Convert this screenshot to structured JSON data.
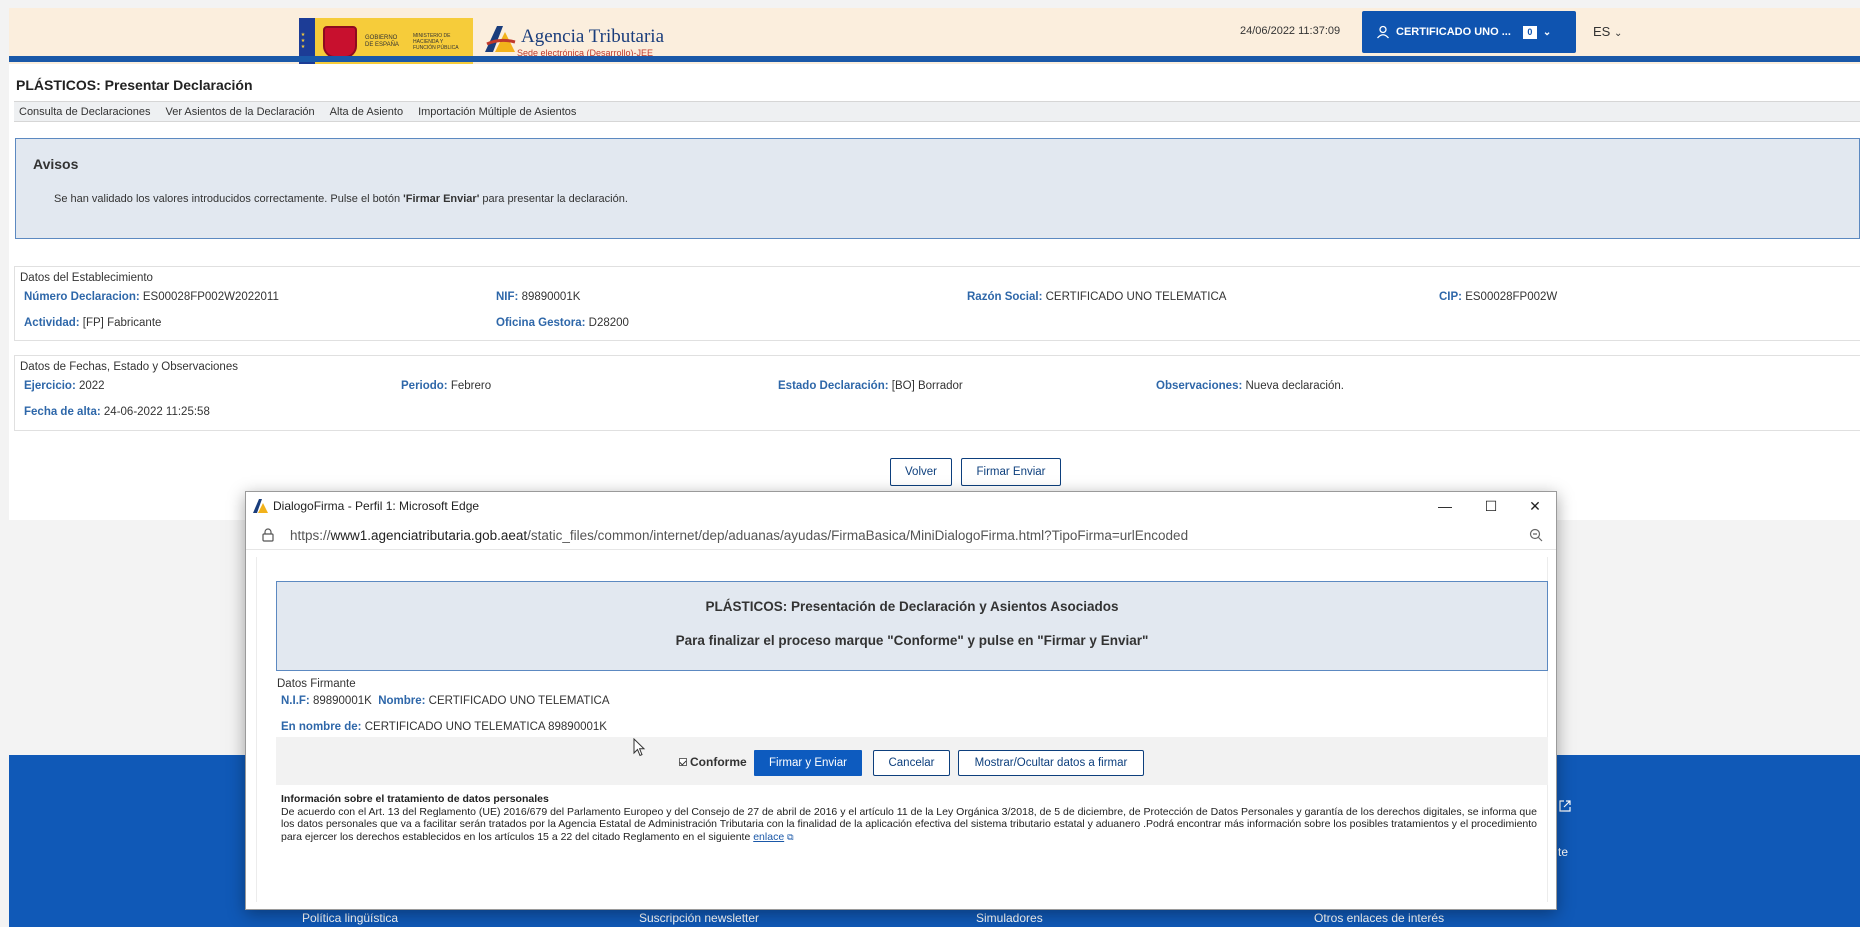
{
  "header": {
    "gov_text": "Gobierno de España",
    "ministry_text": "Ministerio de Hacienda y Función Pública",
    "brand_title": "Agencia Tributaria",
    "brand_sub": "Sede electrónica (Desarrollo)-JEE",
    "datetime": "24/06/2022 11:37:09",
    "cert_label": "CERTIFICADO UNO ...",
    "cert_badge": "0",
    "lang": "ES"
  },
  "page": {
    "title": "PLÁSTICOS: Presentar Declaración",
    "menu": [
      "Consulta de Declaraciones",
      "Ver Asientos de la Declaración",
      "Alta de Asiento",
      "Importación Múltiple de Asientos"
    ]
  },
  "avisos": {
    "title": "Avisos",
    "msg_pre": "Se han validado los valores introducidos correctamente. Pulse el botón ",
    "msg_bold": "'Firmar Enviar'",
    "msg_post": " para presentar la declaración."
  },
  "establecimiento": {
    "title": "Datos del Establecimiento",
    "num_decl_label": "Número Declaracion:",
    "num_decl_value": "ES00028FP002W2022011",
    "nif_label": "NIF:",
    "nif_value": "89890001K",
    "razon_label": "Razón Social:",
    "razon_value": "CERTIFICADO UNO TELEMATICA",
    "cip_label": "CIP:",
    "cip_value": "ES00028FP002W",
    "actividad_label": "Actividad:",
    "actividad_value": "[FP] Fabricante",
    "oficina_label": "Oficina Gestora:",
    "oficina_value": "D28200"
  },
  "fechas": {
    "title": "Datos de Fechas, Estado y Observaciones",
    "ejercicio_label": "Ejercicio:",
    "ejercicio_value": "2022",
    "periodo_label": "Periodo:",
    "periodo_value": "Febrero",
    "estado_label": "Estado Declaración:",
    "estado_value": "[BO] Borrador",
    "obs_label": "Observaciones:",
    "obs_value": "Nueva declaración.",
    "alta_label": "Fecha de alta:",
    "alta_value": "24-06-2022 11:25:58"
  },
  "actions": {
    "volver": "Volver",
    "firmar_enviar": "Firmar Enviar"
  },
  "dialog": {
    "window_title": "DialogoFirma - Perfil 1: Microsoft Edge",
    "url_prefix": "https://",
    "url_host": "www1.agenciatributaria.gob.aeat",
    "url_path": "/static_files/common/internet/dep/aduanas/ayudas/FirmaBasica/MiniDialogoFirma.html?TipoFirma=urlEncoded",
    "box_title": "PLÁSTICOS: Presentación de Declaración y Asientos Asociados",
    "box_subtitle": "Para finalizar el proceso marque \"Conforme\" y pulse en \"Firmar y Enviar\"",
    "firmante_title": "Datos Firmante",
    "nif_label": "N.I.F:",
    "nif_value": "89890001K",
    "nombre_label": "Nombre:",
    "nombre_value": "CERTIFICADO UNO TELEMATICA",
    "en_nombre_label": "En nombre de:",
    "en_nombre_value": "CERTIFICADO UNO TELEMATICA  89890001K",
    "conforme_label": "Conforme",
    "btn_firmar": "Firmar y Enviar",
    "btn_cancelar": "Cancelar",
    "btn_mostrar": "Mostrar/Ocultar datos a firmar",
    "info_title": "Información sobre el tratamiento de datos personales",
    "info_text": "De acuerdo con el Art. 13 del Reglamento (UE) 2016/679 del Parlamento Europeo y del Consejo de 27 de abril de 2016 y el artículo 11 de la Ley Orgánica 3/2018, de 5 de diciembre, de Protección de Datos Personales y garantía de los derechos digitales, se informa que los datos personales que va a facilitar serán tratados por la Agencia Estatal de Administración Tributaria con la finalidad de la aplicación efectiva del sistema tributario estatal y aduanero .Podrá encontrar más información sobre los posibles tratamientos y el procedimiento para ejercer los derechos establecidos en los artículos 15 a 22 del citado Reglamento en el siguiente",
    "info_link": "enlace"
  },
  "footer": {
    "links": [
      "Política lingüística",
      "Suscripción newsletter",
      "Simuladores",
      "Otros enlaces de interés"
    ],
    "frag_text": "te"
  },
  "colors": {
    "accent": "#1a58a8",
    "header_bg": "#fbeedd",
    "footer_bg": "#1059b7",
    "notice_bg": "#e2e8f0",
    "primary_button": "#0d5bbf"
  }
}
